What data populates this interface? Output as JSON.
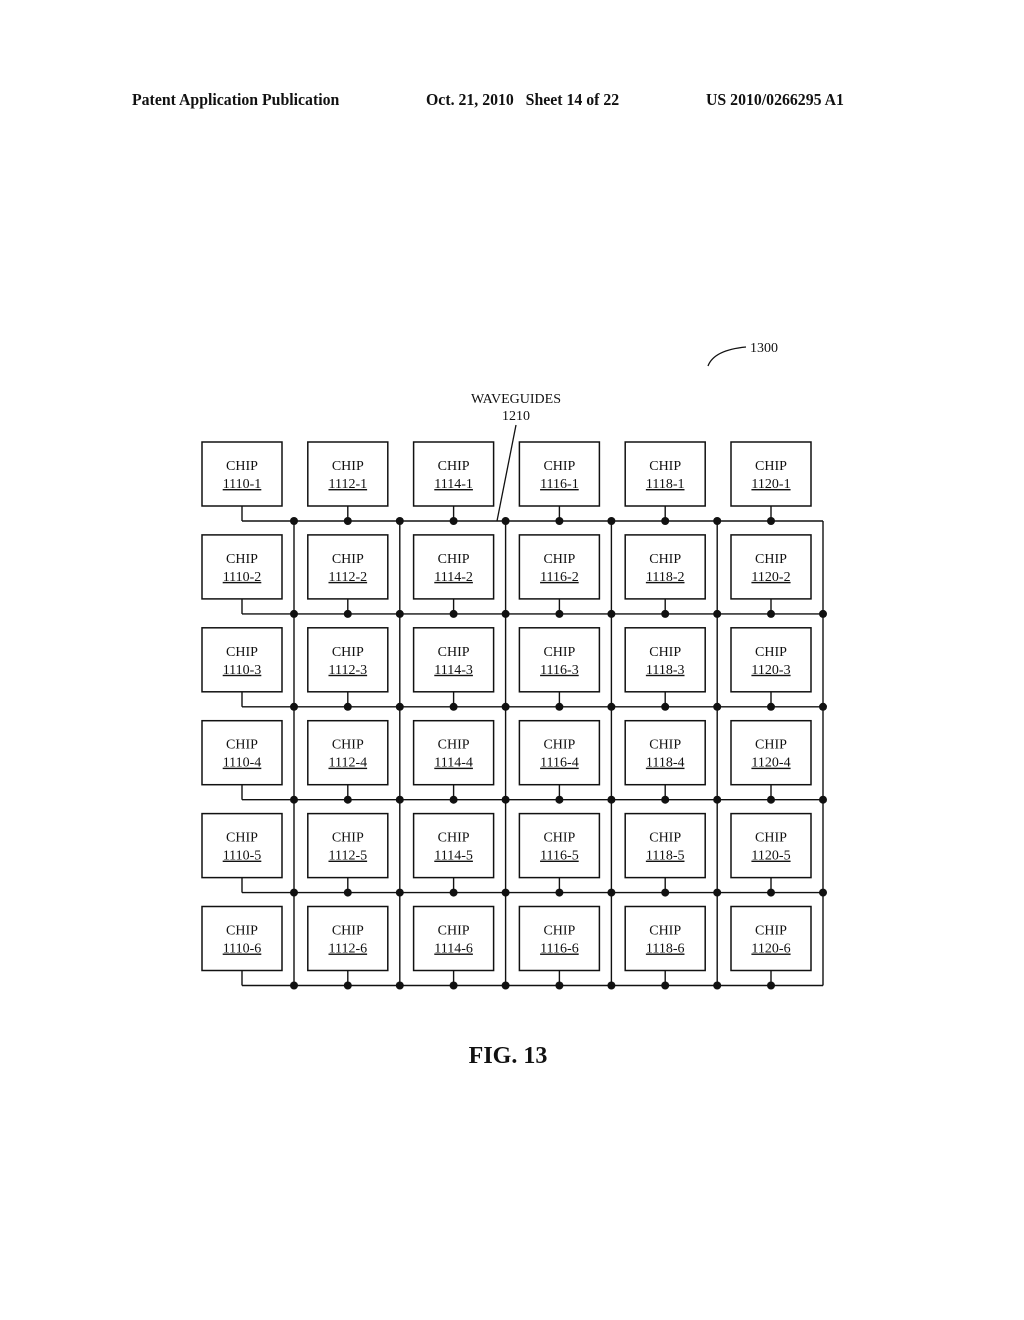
{
  "header": {
    "publication": "Patent Application Publication",
    "date_sheet": "Oct. 21, 2010   Sheet 14 of 22",
    "number": "US 2010/0266295 A1"
  },
  "figure": {
    "reference": "1300",
    "waveguides_label": "WAVEGUIDES",
    "waveguides_ref": "1210",
    "caption": "FIG. 13",
    "chip_word": "CHIP",
    "column_prefixes": [
      "1110",
      "1112",
      "1114",
      "1116",
      "1118",
      "1120"
    ],
    "row_suffixes": [
      "1",
      "2",
      "3",
      "4",
      "5",
      "6"
    ],
    "chips": [
      [
        "1110-1",
        "1112-1",
        "1114-1",
        "1116-1",
        "1118-1",
        "1120-1"
      ],
      [
        "1110-2",
        "1112-2",
        "1114-2",
        "1116-2",
        "1118-2",
        "1120-2"
      ],
      [
        "1110-3",
        "1112-3",
        "1114-3",
        "1116-3",
        "1118-3",
        "1120-3"
      ],
      [
        "1110-4",
        "1112-4",
        "1114-4",
        "1116-4",
        "1118-4",
        "1120-4"
      ],
      [
        "1110-5",
        "1112-5",
        "1114-5",
        "1116-5",
        "1118-5",
        "1120-5"
      ],
      [
        "1110-6",
        "1112-6",
        "1114-6",
        "1116-6",
        "1118-6",
        "1120-6"
      ]
    ]
  }
}
